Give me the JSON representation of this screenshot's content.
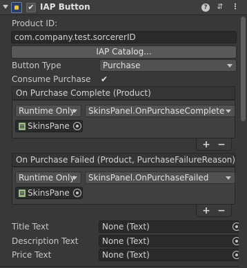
{
  "component": {
    "title": "IAP Button",
    "enabled_mark": "✔",
    "help_glyph": "?",
    "presets_glyph": "⇵",
    "menu_glyph": "⋮"
  },
  "fields": {
    "product_id_label": "Product ID:",
    "product_id_value": "com.company.test.sorcererID",
    "iap_catalog_button": "IAP Catalog...",
    "button_type_label": "Button Type",
    "button_type_value": "Purchase",
    "consume_purchase_label": "Consume Purchase",
    "consume_purchase_checked": "✔"
  },
  "events": [
    {
      "header": "On Purchase Complete (Product)",
      "runtime": "Runtime Only",
      "function": "SkinsPanel.OnPurchaseComplete",
      "object": "SkinsPane",
      "add": "+",
      "remove": "−"
    },
    {
      "header": "On Purchase Failed (Product, PurchaseFailureReason)",
      "runtime": "Runtime Only",
      "function": "SkinsPanel.OnPurchaseFailed",
      "object": "SkinsPane",
      "add": "+",
      "remove": "−"
    }
  ],
  "texts": [
    {
      "label": "Title Text",
      "value": "None (Text)"
    },
    {
      "label": "Description Text",
      "value": "None (Text)"
    },
    {
      "label": "Price Text",
      "value": "None (Text)"
    }
  ]
}
